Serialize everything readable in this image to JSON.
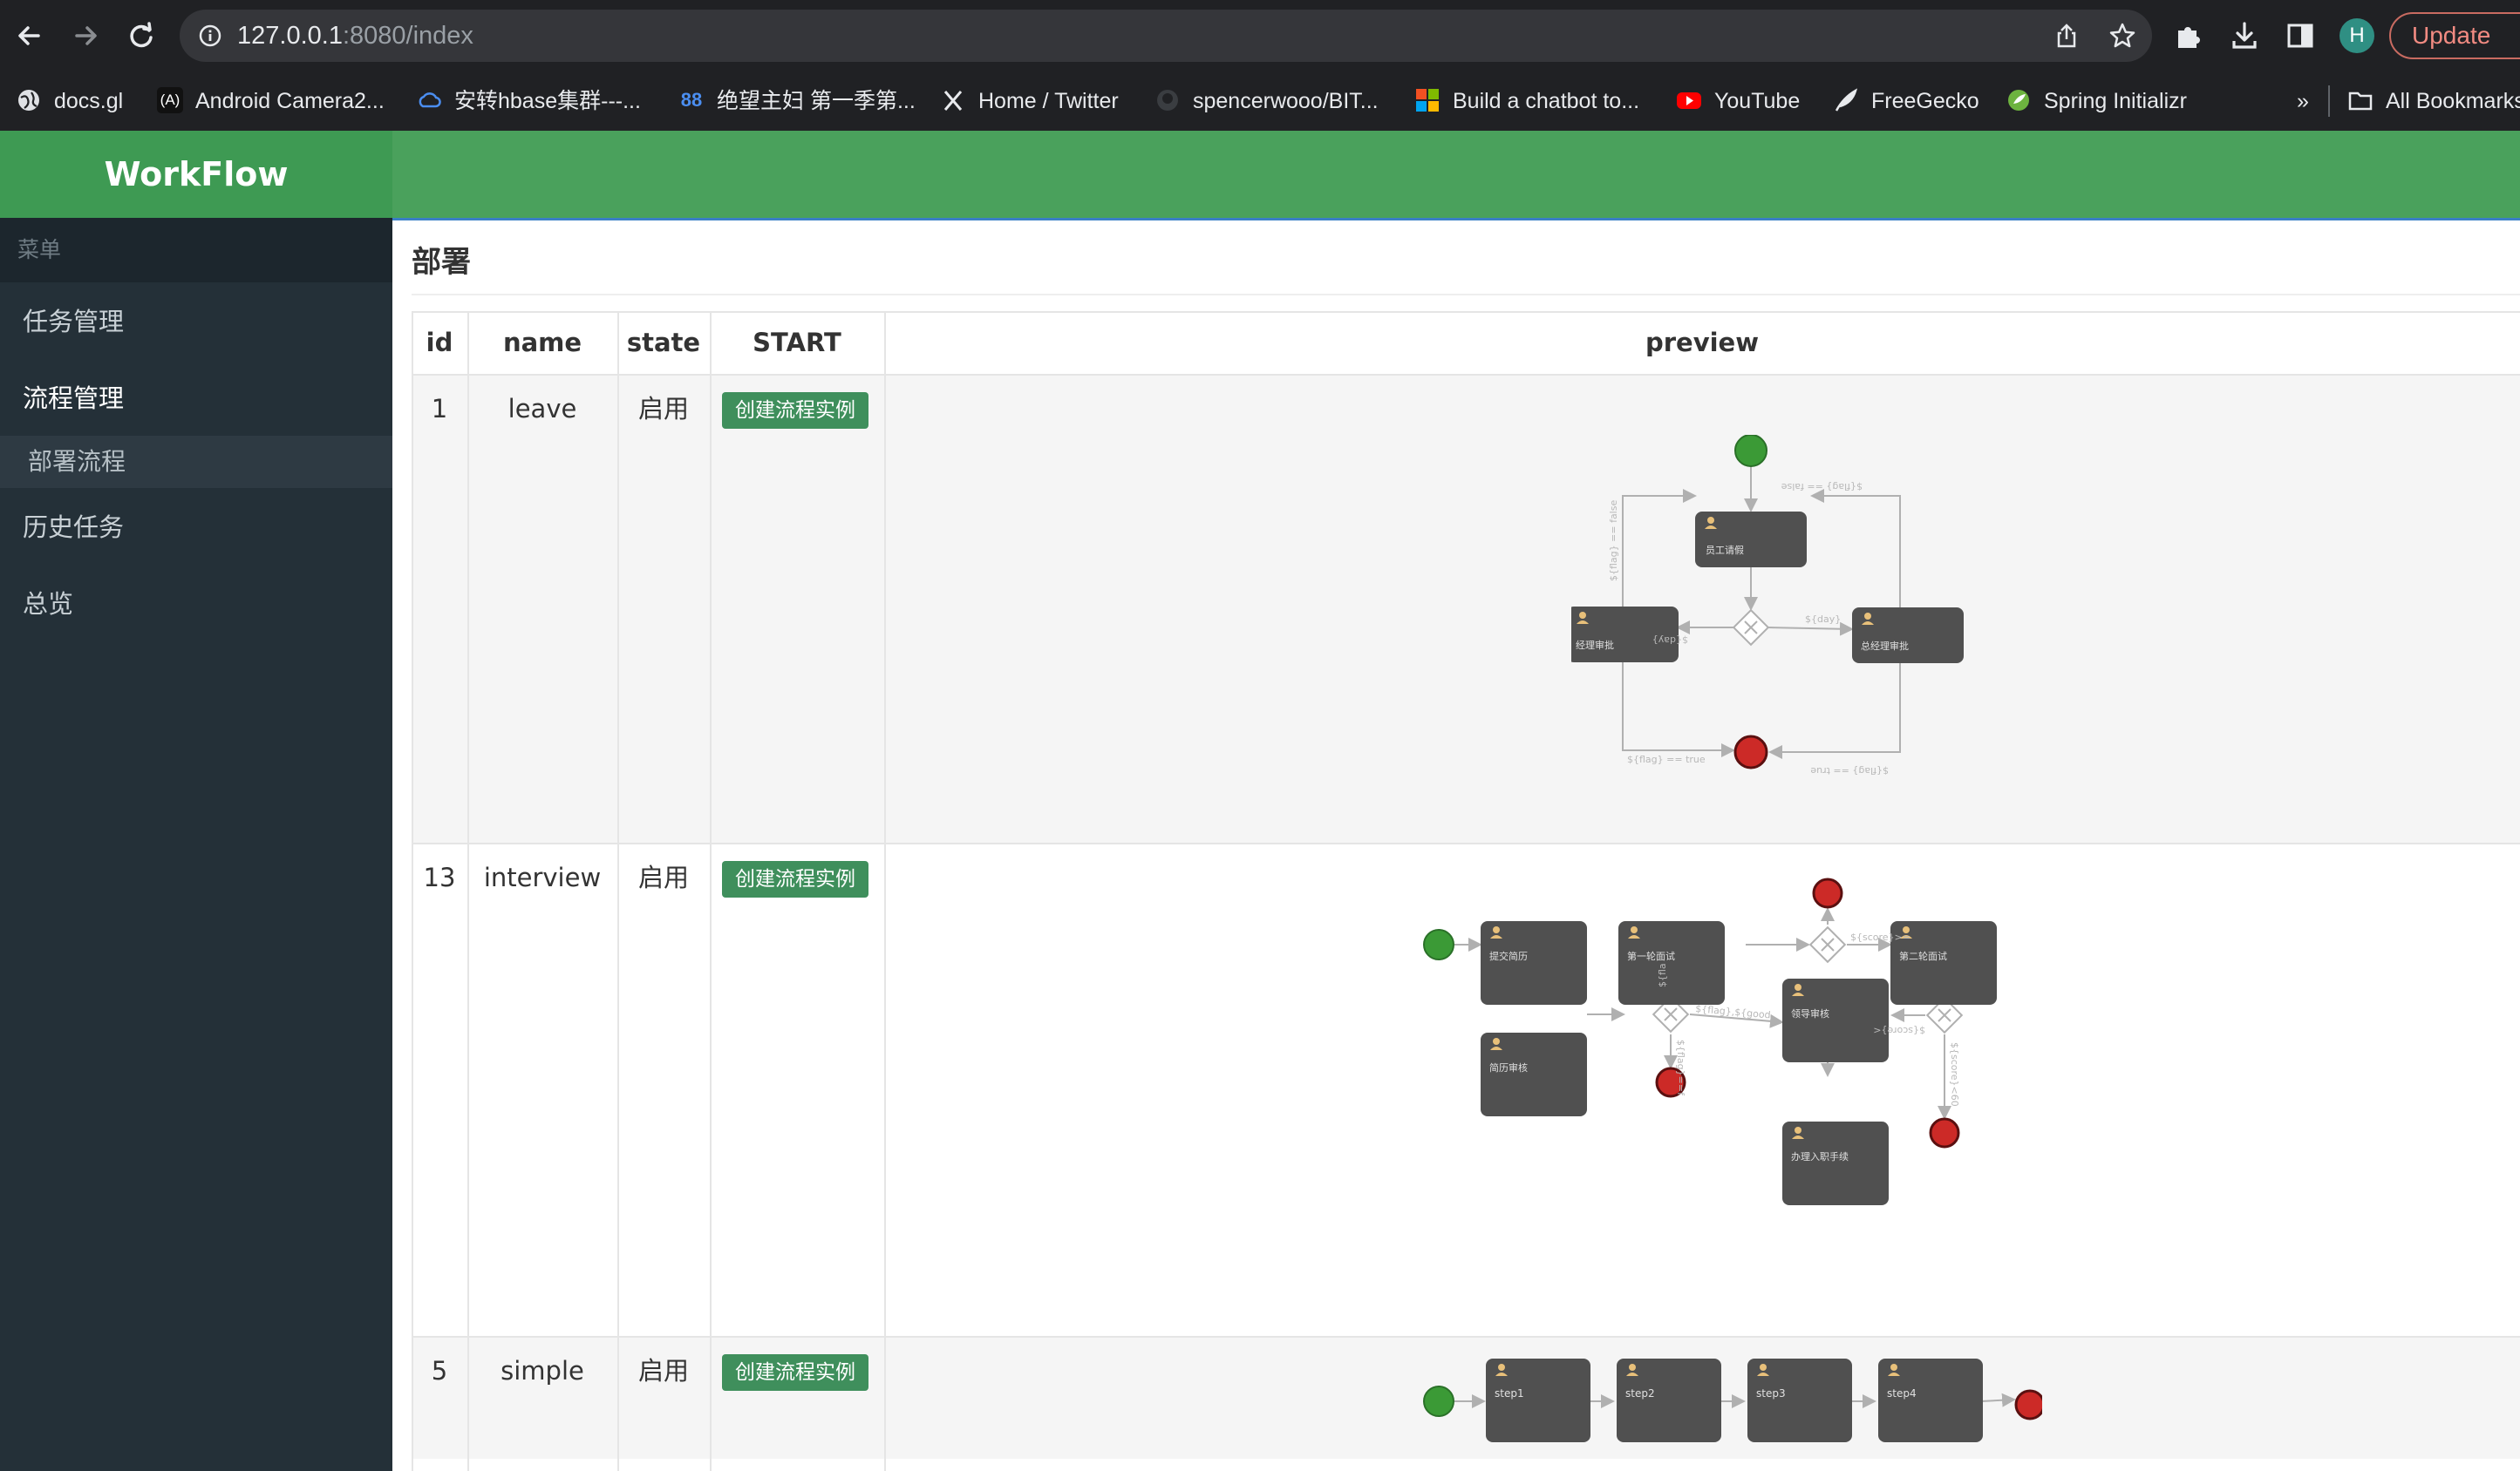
{
  "browser": {
    "url_host": "127.0.0.1",
    "url_rest": ":8080/index",
    "profile_initial": "H",
    "update_label": "Update",
    "bookmarks": [
      {
        "label": "docs.gl",
        "icon": "globe-icon"
      },
      {
        "label": "Android Camera2...",
        "icon": "android-icon"
      },
      {
        "label": "安转hbase集群---...",
        "icon": "cloud-icon"
      },
      {
        "label": "绝望主妇 第一季第...",
        "icon": "number-icon"
      },
      {
        "label": "Home / Twitter",
        "icon": "x-icon"
      },
      {
        "label": "spencerwooo/BIT...",
        "icon": "github-icon"
      },
      {
        "label": "Build a chatbot to...",
        "icon": "microsoft-icon"
      },
      {
        "label": "YouTube",
        "icon": "youtube-icon"
      },
      {
        "label": "FreeGecko",
        "icon": "feather-icon"
      },
      {
        "label": "Spring Initializr",
        "icon": "spring-icon"
      }
    ],
    "more_label": "»",
    "all_bookmarks_label": "All Bookmarks"
  },
  "app": {
    "brand": "WorkFlow",
    "menu_caption": "菜单",
    "menu": [
      {
        "label": "任务管理"
      },
      {
        "label": "流程管理"
      },
      {
        "label": "部署流程"
      },
      {
        "label": "历史任务"
      },
      {
        "label": "总览"
      }
    ],
    "page_title": "部署",
    "columns": [
      "id",
      "name",
      "state",
      "START",
      "preview"
    ],
    "rows": [
      {
        "id": "1",
        "name": "leave",
        "state": "启用",
        "start_label": "创建流程实例"
      },
      {
        "id": "13",
        "name": "interview",
        "state": "启用",
        "start_label": "创建流程实例"
      },
      {
        "id": "5",
        "name": "simple",
        "state": "启用",
        "start_label": "创建流程实例"
      }
    ]
  },
  "diagrams": {
    "leave": {
      "tasks": [
        "员工请假",
        "经理审批",
        "总经理审批"
      ],
      "conditions": [
        "${flag} == false",
        "${flag} == false",
        "${day}",
        "${day}",
        "${flag} == true",
        "${flag} == true"
      ]
    },
    "interview": {
      "tasks": [
        "提交简历",
        "第一轮面试",
        "第二轮面试",
        "简历审核",
        "领导审核",
        "办理入职手续"
      ],
      "conditions": [
        "${score}>=",
        "${fla",
        "${flag},${good",
        "${score}<",
        "${flag}==f",
        "${score}<60"
      ]
    },
    "simple": {
      "tasks": [
        "step1",
        "step2",
        "step3",
        "step4"
      ]
    }
  },
  "colors": {
    "header_green": "#4aa15c",
    "sidebar_dark": "#243038",
    "start_green": "#3f8f5c",
    "task_gray": "#505050",
    "start_event": "#3b9a36",
    "end_event": "#cc2a27"
  }
}
